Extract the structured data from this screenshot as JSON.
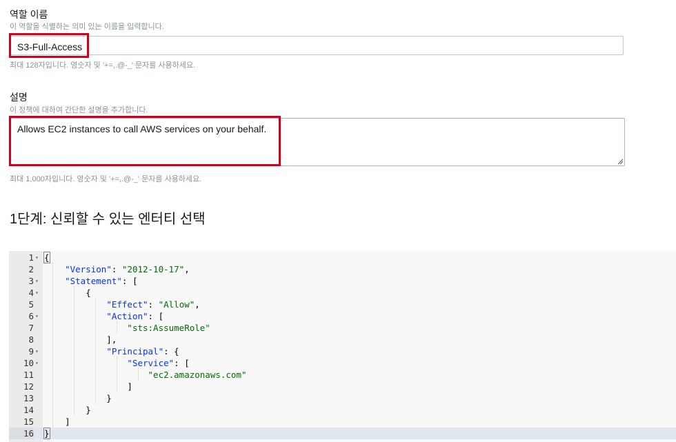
{
  "role_name": {
    "label": "역할 이름",
    "hint": "이 역할을 식별하는 의미 있는 이름을 입력합니다.",
    "value": "S3-Full-Access",
    "note": "최대 128자입니다. 영숫자 및 '+=,.@-_' 문자를 사용하세요."
  },
  "description": {
    "label": "설명",
    "hint": "이 정책에 대하여 간단한 설명을 추가합니다.",
    "value": "Allows EC2 instances to call AWS services on your behalf.",
    "note": "최대 1,000자입니다. 영숫자 및 '+=,.@-_' 문자를 사용하세요."
  },
  "step_heading": "1단계: 신뢰할 수 있는 엔터티 선택",
  "editor": {
    "active_line": 16,
    "lines": [
      {
        "n": "1",
        "fold": true
      },
      {
        "n": "2",
        "fold": false
      },
      {
        "n": "3",
        "fold": true
      },
      {
        "n": "4",
        "fold": true
      },
      {
        "n": "5",
        "fold": false
      },
      {
        "n": "6",
        "fold": true
      },
      {
        "n": "7",
        "fold": false
      },
      {
        "n": "8",
        "fold": false
      },
      {
        "n": "9",
        "fold": true
      },
      {
        "n": "10",
        "fold": true
      },
      {
        "n": "11",
        "fold": false
      },
      {
        "n": "12",
        "fold": false
      },
      {
        "n": "13",
        "fold": false
      },
      {
        "n": "14",
        "fold": false
      },
      {
        "n": "15",
        "fold": false
      },
      {
        "n": "16",
        "fold": false
      }
    ],
    "tokens": {
      "version_key": "\"Version\"",
      "version_val": "\"2012-10-17\"",
      "statement_key": "\"Statement\"",
      "effect_key": "\"Effect\"",
      "effect_val": "\"Allow\"",
      "action_key": "\"Action\"",
      "action_val": "\"sts:AssumeRole\"",
      "principal_key": "\"Principal\"",
      "service_key": "\"Service\"",
      "service_val": "\"ec2.amazonaws.com\""
    }
  },
  "colors": {
    "highlight_border": "#d1001c",
    "json_key": "#0431fa",
    "json_string": "#036a07"
  }
}
